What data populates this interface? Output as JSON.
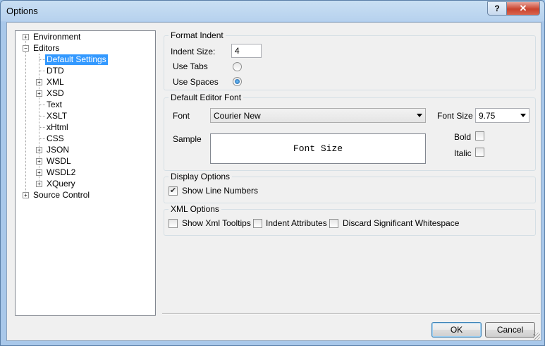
{
  "window": {
    "title": "Options",
    "help_glyph": "?",
    "close_glyph": "✕"
  },
  "tree": {
    "items": [
      {
        "label": "Environment",
        "expander": "+"
      },
      {
        "label": "Editors",
        "expander": "−"
      },
      {
        "label": "Default Settings",
        "selected": true
      },
      {
        "label": "DTD"
      },
      {
        "label": "XML",
        "expander": "+"
      },
      {
        "label": "XSD",
        "expander": "+"
      },
      {
        "label": "Text"
      },
      {
        "label": "XSLT"
      },
      {
        "label": "xHtml"
      },
      {
        "label": "CSS"
      },
      {
        "label": "JSON",
        "expander": "+"
      },
      {
        "label": "WSDL",
        "expander": "+"
      },
      {
        "label": "WSDL2",
        "expander": "+"
      },
      {
        "label": "XQuery",
        "expander": "+"
      },
      {
        "label": "Source Control",
        "expander": "+"
      }
    ]
  },
  "format_indent": {
    "title": "Format Indent",
    "indent_size_label": "Indent Size:",
    "indent_size_value": "4",
    "use_tabs_label": "Use Tabs",
    "use_tabs_checked": false,
    "use_spaces_label": "Use Spaces",
    "use_spaces_checked": true
  },
  "editor_font": {
    "title": "Default Editor Font",
    "font_label": "Font",
    "font_value": "Courier New",
    "font_size_label": "Font Size",
    "font_size_value": "9.75",
    "sample_label": "Sample",
    "sample_text": "Font Size",
    "bold_label": "Bold",
    "bold_checked": false,
    "italic_label": "Italic",
    "italic_checked": false
  },
  "display_options": {
    "title": "Display Options",
    "show_line_numbers_label": "Show Line Numbers",
    "show_line_numbers_checked": true
  },
  "xml_options": {
    "title": "XML Options",
    "show_xml_tooltips_label": "Show Xml Tooltips",
    "indent_attributes_label": "Indent Attributes",
    "discard_whitespace_label": "Discard Significant Whitespace"
  },
  "buttons": {
    "ok_label": "OK",
    "cancel_label": "Cancel"
  },
  "checkmark_glyph": "✔"
}
